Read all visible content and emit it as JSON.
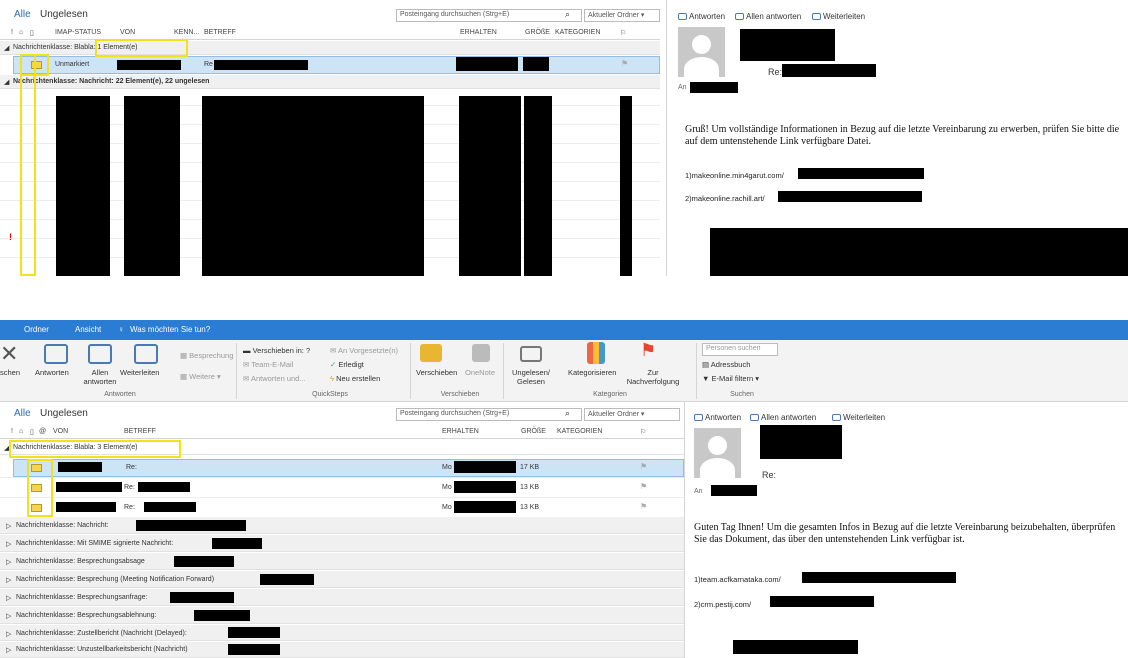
{
  "top": {
    "tabs": {
      "all": "Alle",
      "unread": "Ungelesen"
    },
    "search_placeholder": "Posteingang durchsuchen (Strg+E)",
    "scope": "Aktueller Ordner",
    "columns": {
      "imap": "IMAP-STATUS",
      "von": "VON",
      "kenn": "KENN...",
      "betreff": "BETREFF",
      "erhalten": "ERHALTEN",
      "groesse": "GRÖßE",
      "kategorien": "KATEGORIEN"
    },
    "group1": "Nachrichtenklasse: Blabla: 1 Element(e)",
    "row1_status": "Unmarkiert",
    "row1_subject": "Re",
    "group2": "Nachrichtenklasse: Nachricht: 22 Element(e), 22 ungelesen",
    "reply_actions": {
      "reply": "Antworten",
      "reply_all": "Allen antworten",
      "forward": "Weiterleiten"
    },
    "re_label": "Re:",
    "to_label": "An",
    "body": "Gruß! Um vollständige Informationen in Bezug auf die letzte Vereinbarung zu erwerben, prüfen Sie bitte die auf dem untenstehende Link verfügbare Datei.",
    "link1": "1)makeonline.min4garut.com/",
    "link2": "2)makeonline.rachill.art/"
  },
  "bottom": {
    "menubar": {
      "folder": "Ordner",
      "view": "Ansicht",
      "tell_me": "Was möchten Sie tun?"
    },
    "ribbon": {
      "delete_partial": "schen",
      "reply": "Antworten",
      "reply_all": "Allen antworten",
      "forward": "Weiterleiten",
      "meeting": "Besprechung",
      "more": "Weitere",
      "group_respond": "Antworten",
      "qs_move": "Verschieben in: ?",
      "qs_team": "Team-E-Mail",
      "qs_reply_delete": "Antworten und...",
      "qs_manager": "An Vorgesetzte(n)",
      "qs_done": "Erledigt",
      "qs_new": "Neu erstellen",
      "group_quicksteps": "QuickSteps",
      "move": "Verschieben",
      "onenote": "OneNote",
      "group_move": "Verschieben",
      "unread_read": "Ungelesen/ Gelesen",
      "categorize": "Kategorisieren",
      "followup": "Zur Nachverfolgung",
      "group_tags": "Kategorien",
      "find_people": "Personen suchen",
      "address_book": "Adressbuch",
      "filter_email": "E-Mail filtern",
      "group_find": "Suchen"
    },
    "tabs": {
      "all": "Alle",
      "unread": "Ungelesen"
    },
    "search_placeholder": "Posteingang durchsuchen (Strg+E)",
    "scope": "Aktueller Ordner",
    "columns": {
      "von": "VON",
      "betreff": "BETREFF",
      "erhalten": "ERHALTEN",
      "groesse": "GRÖßE",
      "kategorien": "KATEGORIEN"
    },
    "group1": "Nachrichtenklasse: Blabla: 3 Element(e)",
    "rows": [
      {
        "subject": "Re:",
        "received": "Mo",
        "size": "17 KB"
      },
      {
        "subject": "Re:",
        "received": "Mo",
        "size": "13 KB"
      },
      {
        "subject": "Re:",
        "received": "Mo",
        "size": "13 KB"
      }
    ],
    "groups": [
      "Nachrichtenklasse: Nachricht:",
      "Nachrichtenklasse: Mit SMIME signierte Nachricht:",
      "Nachrichtenklasse: Besprechungsabsage",
      "Nachrichtenklasse: Besprechung (Meeting Notification Forward)",
      "Nachrichtenklasse: Besprechungsanfrage:",
      "Nachrichtenklasse: Besprechungsablehnung:",
      "Nachrichtenklasse: Zustellbericht (Nachricht (Delayed):",
      "Nachrichtenklasse: Unzustellbarkeitsbericht (Nachricht)"
    ],
    "reply_actions": {
      "reply": "Antworten",
      "reply_all": "Allen antworten",
      "forward": "Weiterleiten"
    },
    "re_label": "Re:",
    "to_label": "An",
    "body": "Guten Tag Ihnen! Um die gesamten Infos in Bezug auf die letzte Vereinbarung beizubehalten, überprüfen Sie das Dokument, das über den untenstehenden Link verfügbar ist.",
    "link1": "1)team.acfkarnataka.com/",
    "link2": "2)crm.pestij.com/"
  }
}
